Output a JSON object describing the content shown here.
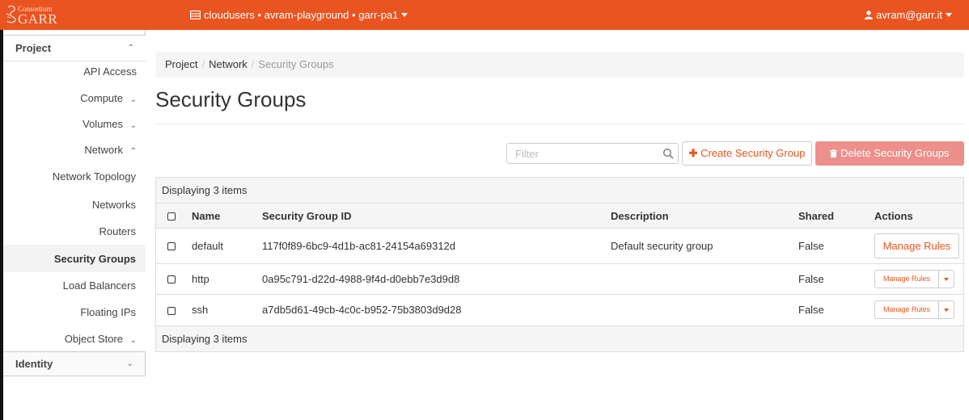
{
  "brand": {
    "line1": "Consortium",
    "line2": "GARR"
  },
  "topbar": {
    "project_switch": "cloudusers • avram-playground • garr-pa1",
    "user": "avram@garr.it"
  },
  "sidebar": {
    "project": "Project",
    "api_access": "API Access",
    "compute": "Compute",
    "volumes": "Volumes",
    "network": "Network",
    "network_topology": "Network Topology",
    "networks": "Networks",
    "routers": "Routers",
    "security_groups": "Security Groups",
    "load_balancers": "Load Balancers",
    "floating_ips": "Floating IPs",
    "object_store": "Object Store",
    "identity": "Identity"
  },
  "breadcrumb": {
    "project": "Project",
    "network": "Network",
    "current": "Security Groups"
  },
  "page_title": "Security Groups",
  "toolbar": {
    "filter_placeholder": "Filter",
    "create": "Create Security Group",
    "delete": "Delete Security Groups"
  },
  "table": {
    "caption": "Displaying 3 items",
    "footer": "Displaying 3 items",
    "columns": {
      "name": "Name",
      "id": "Security Group ID",
      "description": "Description",
      "shared": "Shared",
      "actions": "Actions"
    },
    "rows": [
      {
        "name": "default",
        "id": "117f0f89-6bc9-4d1b-ac81-24154a69312d",
        "description": "Default security group",
        "shared": "False",
        "action": "Manage Rules"
      },
      {
        "name": "http",
        "id": "0a95c791-d22d-4988-9f4d-d0ebb7e3d9d8",
        "description": "",
        "shared": "False",
        "action": "Manage Rules"
      },
      {
        "name": "ssh",
        "id": "a7db5d61-49cb-4c0c-b952-75b3803d9d28",
        "description": "",
        "shared": "False",
        "action": "Manage Rules"
      }
    ]
  },
  "colors": {
    "accent": "#e95420",
    "delete_button": "#ed8f8a"
  }
}
